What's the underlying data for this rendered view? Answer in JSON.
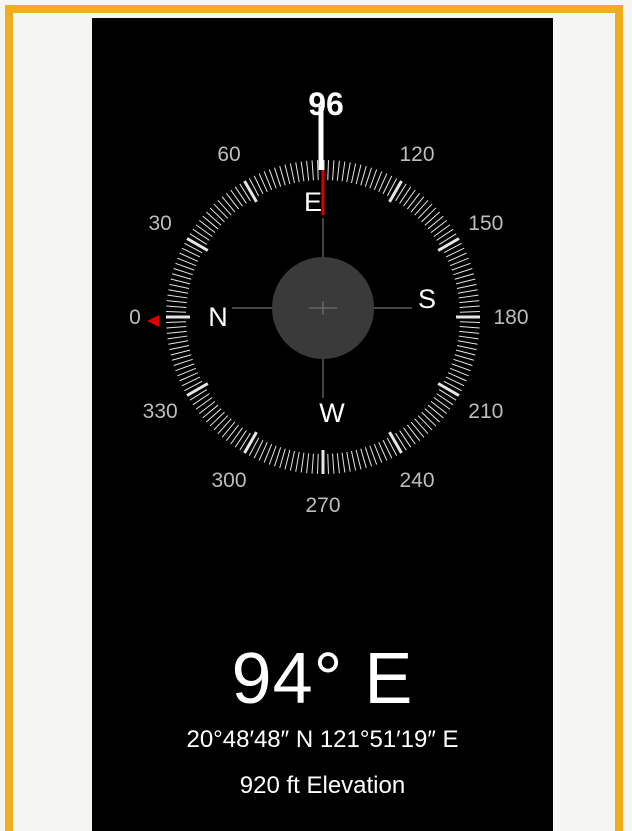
{
  "compass": {
    "current_bearing_label": "96",
    "north_arrow_color": "#d90000",
    "cardinals": {
      "north": "N",
      "east": "E",
      "south": "S",
      "west": "W"
    },
    "degree_labels": [
      {
        "deg": 0,
        "text": "0"
      },
      {
        "deg": 30,
        "text": "30"
      },
      {
        "deg": 60,
        "text": "60"
      },
      {
        "deg": 120,
        "text": "120"
      },
      {
        "deg": 150,
        "text": "150"
      },
      {
        "deg": 180,
        "text": "180"
      },
      {
        "deg": 210,
        "text": "210"
      },
      {
        "deg": 240,
        "text": "240"
      },
      {
        "deg": 270,
        "text": "270"
      },
      {
        "deg": 300,
        "text": "300"
      },
      {
        "deg": 330,
        "text": "330"
      }
    ]
  },
  "reading": {
    "heading": "94° E",
    "coordinates": "20°48′48″ N  121°51′19″ E",
    "elevation": "920 ft Elevation"
  }
}
